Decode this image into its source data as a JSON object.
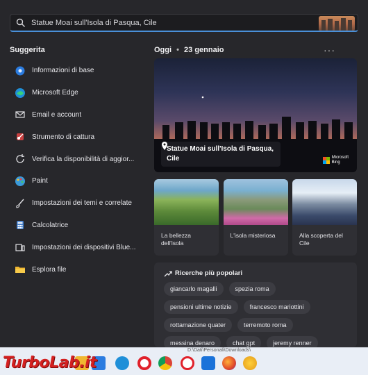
{
  "search": {
    "query": "Statue Moai sull'Isola di Pasqua, Cile"
  },
  "suggested": {
    "title": "Suggerita",
    "items": [
      {
        "label": "Informazioni di base",
        "icon": "gear-info-icon"
      },
      {
        "label": "Microsoft Edge",
        "icon": "edge-icon"
      },
      {
        "label": "Email e account",
        "icon": "mail-icon"
      },
      {
        "label": "Strumento di cattura",
        "icon": "snipping-tool-icon"
      },
      {
        "label": "Verifica la disponibilità di aggior...",
        "icon": "refresh-icon"
      },
      {
        "label": "Paint",
        "icon": "paint-icon"
      },
      {
        "label": "Impostazioni dei temi e correlate",
        "icon": "brush-icon"
      },
      {
        "label": "Calcolatrice",
        "icon": "calculator-icon"
      },
      {
        "label": "Impostazioni dei dispositivi Blue...",
        "icon": "devices-icon"
      },
      {
        "label": "Esplora file",
        "icon": "folder-icon"
      }
    ]
  },
  "today": {
    "title": "Oggi",
    "date": "23 gennaio",
    "more": "···"
  },
  "hero": {
    "caption": "Statue Moai sull'Isola di Pasqua, Cile",
    "brand_line1": "Microsoft",
    "brand_line2": "Bing"
  },
  "cards": [
    {
      "label": "La bellezza dell'isola"
    },
    {
      "label": "L'isola misteriosa"
    },
    {
      "label": "Alla scoperta del Cile"
    }
  ],
  "popular": {
    "title": "Ricerche più popolari",
    "chips": [
      "giancarlo magalli",
      "spezia roma",
      "pensioni ultime notizie",
      "francesco mariottini",
      "rottamazione quater",
      "terremoto roma",
      "messina denaro",
      "chat gpt",
      "jeremy renner"
    ]
  },
  "taskbar": {
    "path": "D:\\Dati\\Personali\\Downloads\\"
  },
  "watermark": {
    "text": "TurboLab.it"
  },
  "colors": {
    "accent": "#4a90d9",
    "panel": "#27272b",
    "card": "#2f2f34",
    "chip": "#3c3c42"
  }
}
